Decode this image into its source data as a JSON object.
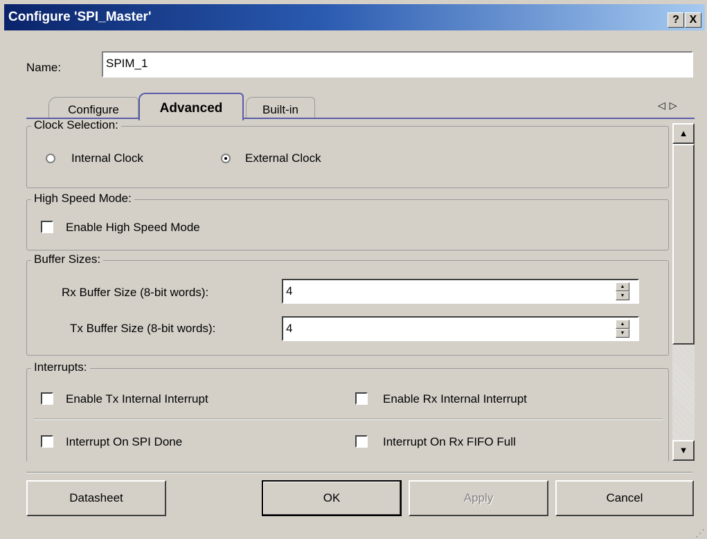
{
  "window": {
    "title": "Configure 'SPI_Master'",
    "help_label": "?",
    "close_label": "X"
  },
  "name": {
    "label": "Name:",
    "value": "SPIM_1"
  },
  "tabs": [
    {
      "label": "Configure",
      "active": false
    },
    {
      "label": "Advanced",
      "active": true
    },
    {
      "label": "Built-in",
      "active": false
    }
  ],
  "tab_nav": {
    "left": "◁",
    "right": "▷"
  },
  "clock_selection": {
    "legend": "Clock Selection:",
    "internal_label": "Internal Clock",
    "external_label": "External Clock",
    "selected": "External Clock"
  },
  "high_speed": {
    "legend": "High Speed Mode:",
    "enable_label": "Enable High Speed Mode",
    "checked": false
  },
  "buffer_sizes": {
    "legend": "Buffer Sizes:",
    "rx_label": "Rx Buffer Size (8-bit words):",
    "rx_value": "4",
    "tx_label": "Tx Buffer Size (8-bit words):",
    "tx_value": "4"
  },
  "interrupts": {
    "legend": "Interrupts:",
    "tx_internal_label": "Enable Tx Internal Interrupt",
    "rx_internal_label": "Enable Rx Internal Interrupt",
    "spi_done_label": "Interrupt On SPI Done",
    "rx_fifo_full_label": "Interrupt On Rx FIFO Full"
  },
  "scrollbar": {
    "up": "▲",
    "down": "▼"
  },
  "buttons": {
    "datasheet": "Datasheet",
    "ok": "OK",
    "apply": "Apply",
    "cancel": "Cancel"
  }
}
